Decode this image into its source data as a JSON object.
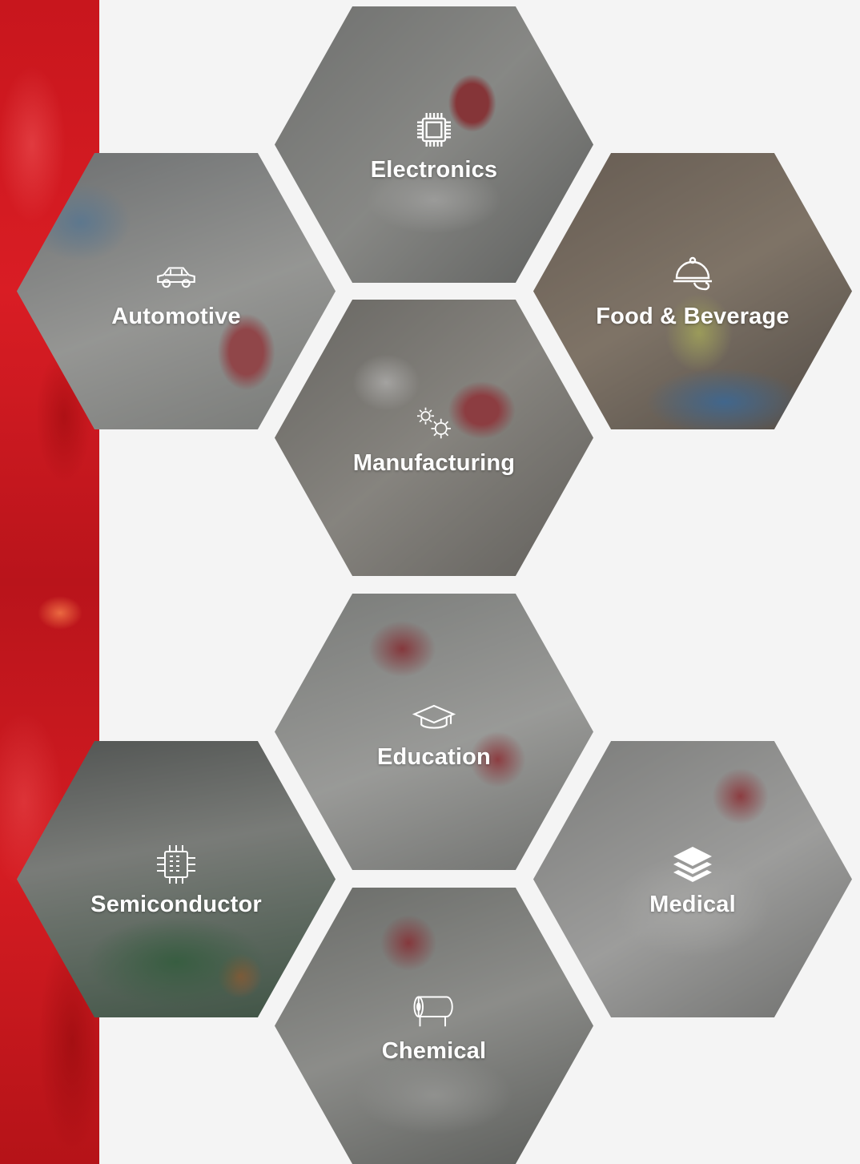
{
  "industries": {
    "electronics": {
      "label": "Electronics",
      "icon": "chip-icon"
    },
    "automotive": {
      "label": "Automotive",
      "icon": "car-icon"
    },
    "food": {
      "label": "Food & Beverage",
      "icon": "cloche-icon"
    },
    "manufacturing": {
      "label": "Manufacturing",
      "icon": "gears-icon"
    },
    "education": {
      "label": "Education",
      "icon": "graduation-cap-icon"
    },
    "semiconductor": {
      "label": "Semiconductor",
      "icon": "microchip-icon"
    },
    "medical": {
      "label": "Medical",
      "icon": "layers-icon"
    },
    "chemical": {
      "label": "Chemical",
      "icon": "paper-roll-icon"
    }
  },
  "colors": {
    "accent_red": "#d21a21",
    "background": "#f4f4f4",
    "label_text": "#ffffff"
  }
}
